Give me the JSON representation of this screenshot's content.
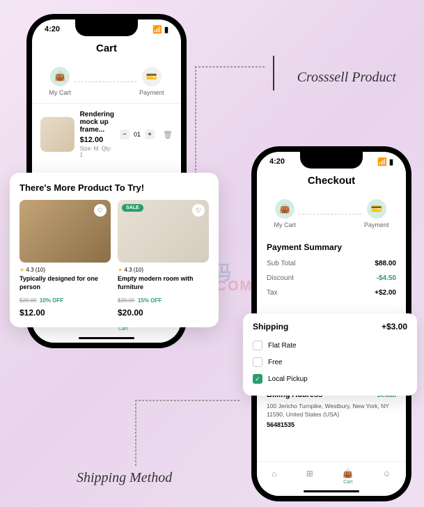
{
  "status": {
    "time": "4:20"
  },
  "annotations": {
    "crosssell": "Crosssell Product",
    "shipping": "Shipping Method"
  },
  "watermark": {
    "line1": "云创源码",
    "line2": "LOOWP.COM"
  },
  "phone1": {
    "title": "Cart",
    "steps": {
      "cart": "My Cart",
      "payment": "Payment"
    },
    "item": {
      "name": "Rendering mock up frame...",
      "price": "$12.00",
      "size": "Size: M",
      "qty_label": "Qty: 1",
      "qty": "01"
    },
    "nav": {
      "cart": "Cart"
    }
  },
  "crosssell": {
    "title": "There's  More Product To Try!",
    "products": [
      {
        "rating": "4.3 (10)",
        "name": "Typically designed for one person",
        "old": "$20.00",
        "off": "10% OFF",
        "price": "$12.00"
      },
      {
        "sale": "SALE",
        "rating": "4.3 (10)",
        "name": "Empty modern room with furniture",
        "old": "$20.00",
        "off": "15% OFF",
        "price": "$20.00"
      }
    ]
  },
  "phone2": {
    "title": "Checkout",
    "steps": {
      "cart": "My Cart",
      "payment": "Payment"
    },
    "summary": {
      "title": "Payment Summary",
      "rows": [
        {
          "label": "Sub Total",
          "val": "$88.00"
        },
        {
          "label": "Discount",
          "val": "-$4.50"
        },
        {
          "label": "Tax",
          "val": "+$2.00"
        }
      ]
    },
    "billing": {
      "title": "Billing Address",
      "default": "Default",
      "addr": "100 Jericho Turnpike, Westbury, New York, NY 11590, United States (USA)",
      "phone": "56481535"
    },
    "nav": {
      "cart": "Cart"
    }
  },
  "shipping": {
    "title": "Shipping",
    "amount": "+$3.00",
    "options": [
      "Flat Rate",
      "Free",
      "Local Pickup"
    ]
  }
}
